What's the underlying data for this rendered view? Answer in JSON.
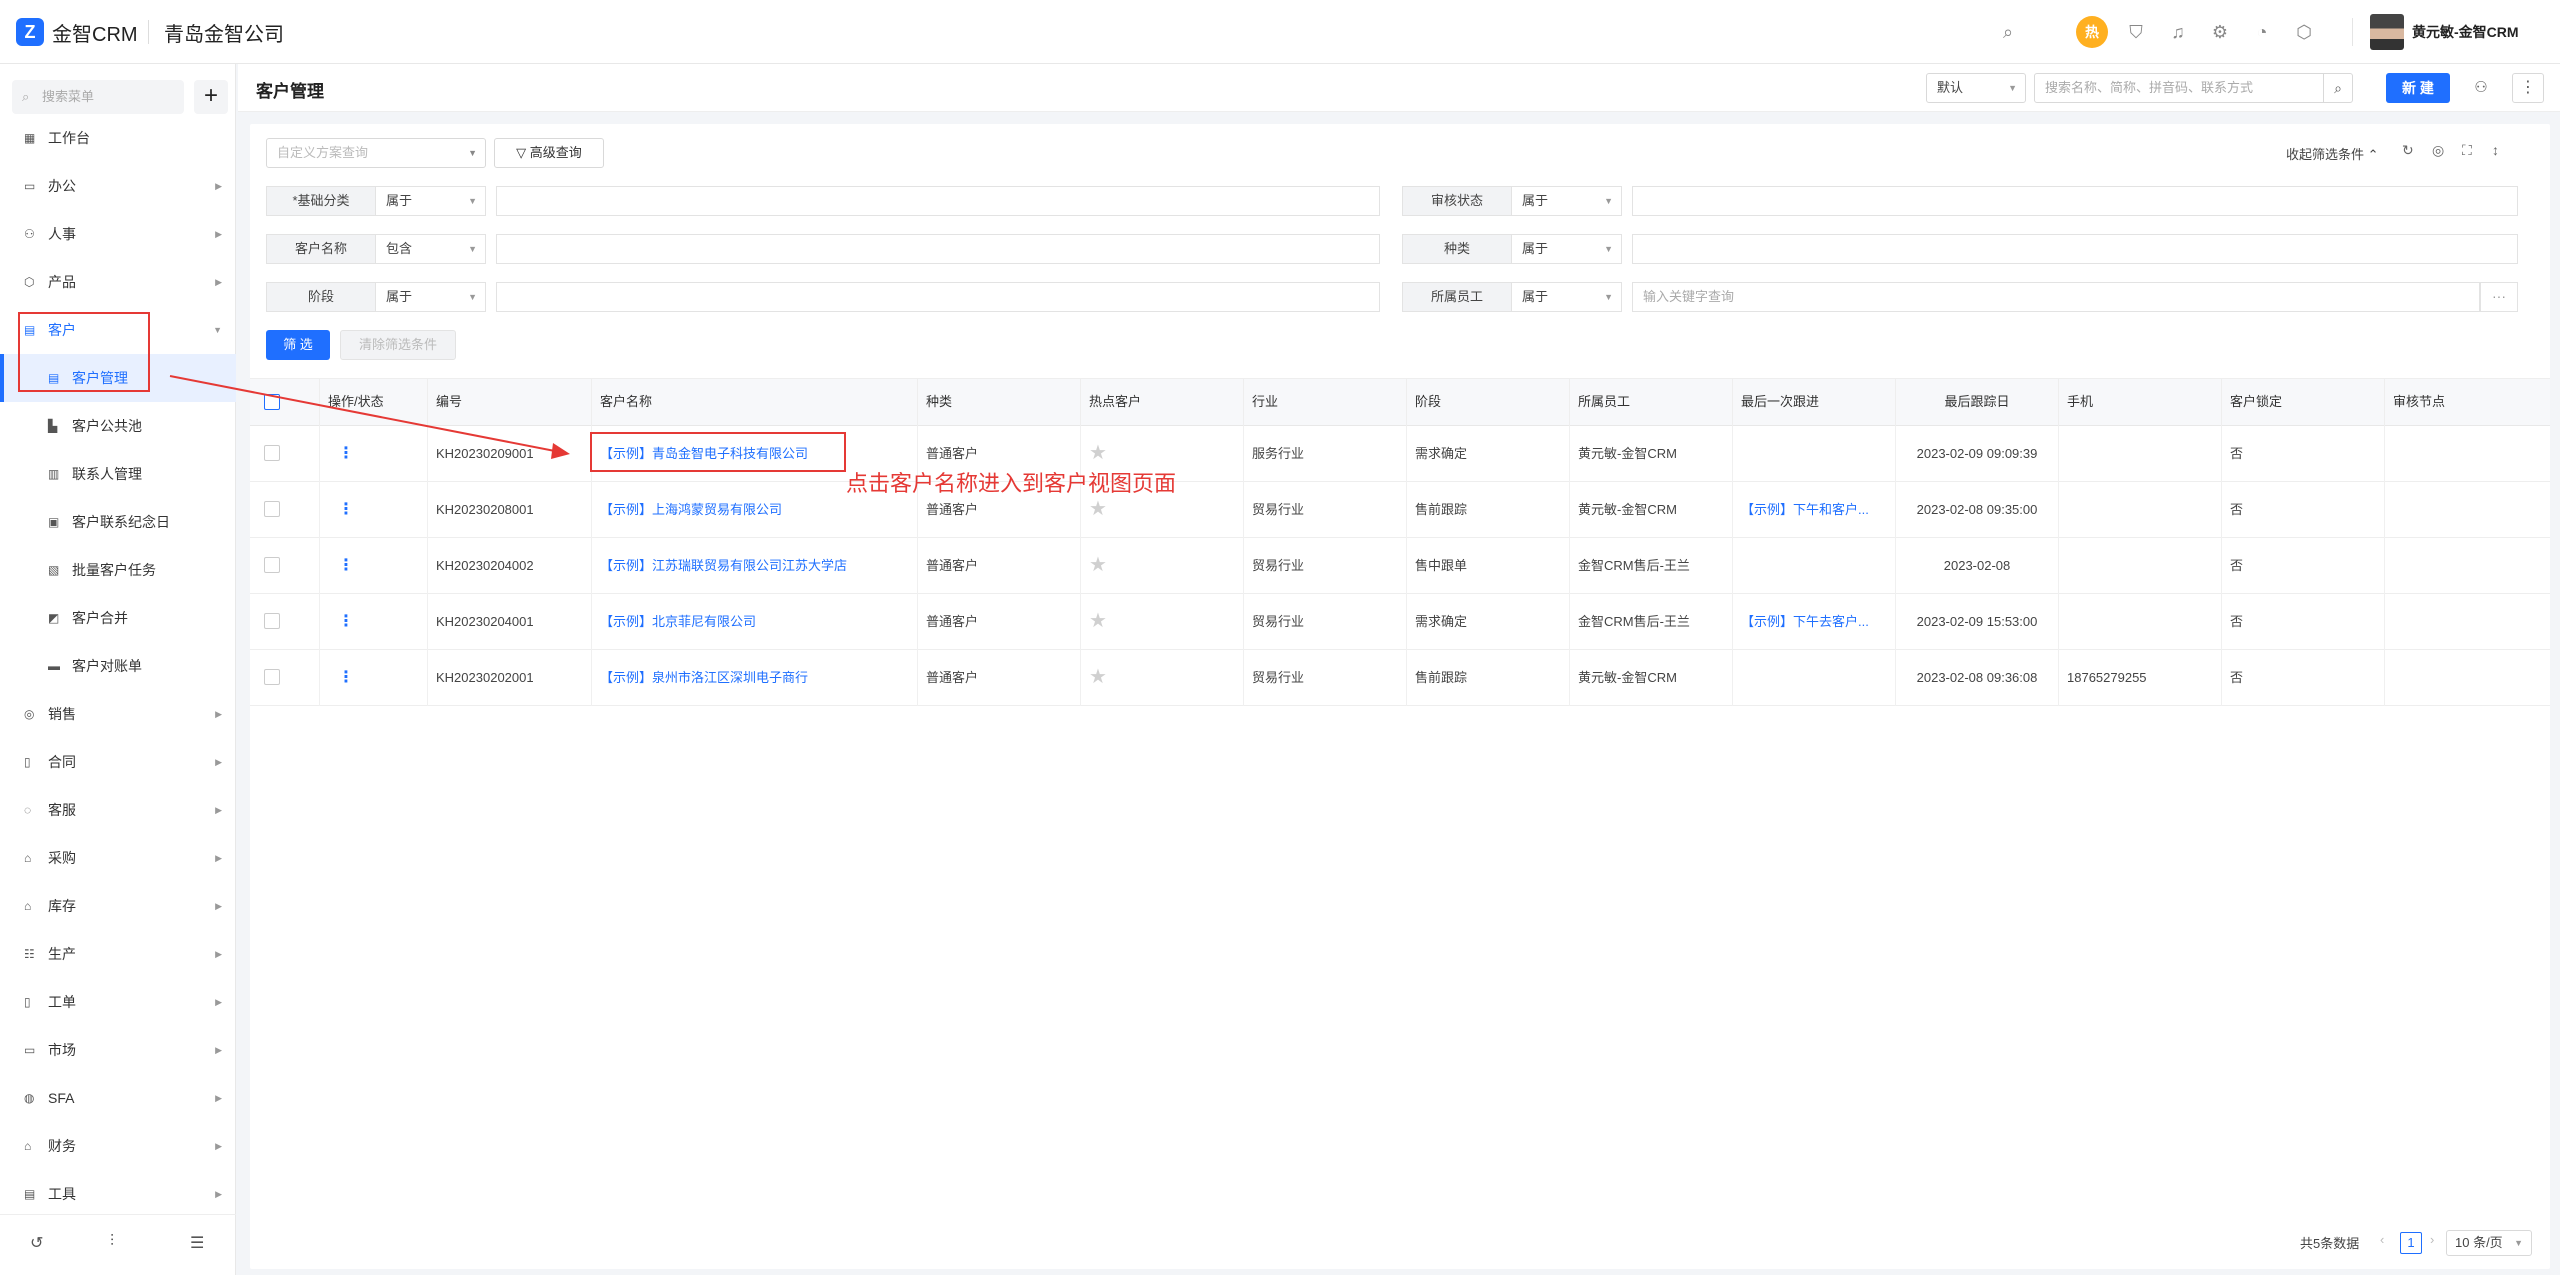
{
  "header": {
    "logo_glyph": "Z",
    "brand": "金智CRM",
    "company": "青岛金智公司",
    "user_name": "黄元敏-金智CRM",
    "hot_badge": "热"
  },
  "sidebar": {
    "search_placeholder": "搜索菜单",
    "add_label": "+",
    "items": [
      {
        "label": "工作台",
        "icon": "dashboard-icon"
      },
      {
        "label": "办公",
        "icon": "office-icon"
      },
      {
        "label": "人事",
        "icon": "people-icon"
      },
      {
        "label": "产品",
        "icon": "product-icon"
      },
      {
        "label": "客户",
        "icon": "customer-icon"
      },
      {
        "label": "销售",
        "icon": "sales-icon"
      },
      {
        "label": "合同",
        "icon": "contract-icon"
      },
      {
        "label": "客服",
        "icon": "service-icon"
      },
      {
        "label": "采购",
        "icon": "purchase-icon"
      },
      {
        "label": "库存",
        "icon": "inventory-icon"
      },
      {
        "label": "生产",
        "icon": "production-icon"
      },
      {
        "label": "工单",
        "icon": "workorder-icon"
      },
      {
        "label": "市场",
        "icon": "market-icon"
      },
      {
        "label": "SFA",
        "icon": "sfa-icon"
      },
      {
        "label": "财务",
        "icon": "finance-icon"
      },
      {
        "label": "工具",
        "icon": "tools-icon"
      }
    ],
    "sub_items": [
      "客户管理",
      "客户公共池",
      "联系人管理",
      "客户联系纪念日",
      "批量客户任务",
      "客户合并",
      "客户对账单"
    ]
  },
  "main": {
    "page_title": "客户管理",
    "view_select": "默认",
    "search_placeholder": "搜索名称、简称、拼音码、联系方式",
    "new_button": "新 建",
    "plan_placeholder": "自定义方案查询",
    "advanced_query": "高级查询",
    "collapse_filters": "收起筛选条件",
    "filters": [
      {
        "label": "*基础分类",
        "op": "属于",
        "value": ""
      },
      {
        "label": "审核状态",
        "op": "属于",
        "value": ""
      },
      {
        "label": "客户名称",
        "op": "包含",
        "value": ""
      },
      {
        "label": "种类",
        "op": "属于",
        "value": ""
      },
      {
        "label": "阶段",
        "op": "属于",
        "value": ""
      },
      {
        "label": "所属员工",
        "op": "属于",
        "value": "输入关键字查询"
      }
    ],
    "filter_button": "筛 选",
    "clear_button": "清除筛选条件"
  },
  "table": {
    "columns": [
      "操作/状态",
      "编号",
      "客户名称",
      "种类",
      "热点客户",
      "行业",
      "阶段",
      "所属员工",
      "最后一次跟进",
      "最后跟踪日",
      "手机",
      "客户锁定",
      "审核节点"
    ],
    "rows": [
      {
        "code": "KH20230209001",
        "name": "【示例】青岛金智电子科技有限公司",
        "kind": "普通客户",
        "industry": "服务行业",
        "stage": "需求确定",
        "owner": "黄元敏-金智CRM",
        "last_follow": "",
        "last_date": "2023-02-09 09:09:39",
        "mobile": "",
        "locked": "否"
      },
      {
        "code": "KH20230208001",
        "name": "【示例】上海鸿蒙贸易有限公司",
        "kind": "普通客户",
        "industry": "贸易行业",
        "stage": "售前跟踪",
        "owner": "黄元敏-金智CRM",
        "last_follow": "【示例】下午和客户...",
        "last_date": "2023-02-08 09:35:00",
        "mobile": "",
        "locked": "否"
      },
      {
        "code": "KH20230204002",
        "name": "【示例】江苏瑞联贸易有限公司江苏大学店",
        "kind": "普通客户",
        "industry": "贸易行业",
        "stage": "售中跟单",
        "owner": "金智CRM售后-王兰",
        "last_follow": "",
        "last_date": "2023-02-08",
        "mobile": "",
        "locked": "否"
      },
      {
        "code": "KH20230204001",
        "name": "【示例】北京菲尼有限公司",
        "kind": "普通客户",
        "industry": "贸易行业",
        "stage": "需求确定",
        "owner": "金智CRM售后-王兰",
        "last_follow": "【示例】下午去客户...",
        "last_date": "2023-02-09 15:53:00",
        "mobile": "",
        "locked": "否"
      },
      {
        "code": "KH20230202001",
        "name": "【示例】泉州市洛江区深圳电子商行",
        "kind": "普通客户",
        "industry": "贸易行业",
        "stage": "售前跟踪",
        "owner": "黄元敏-金智CRM",
        "last_follow": "",
        "last_date": "2023-02-08 09:36:08",
        "mobile": "18765279255",
        "locked": "否"
      }
    ]
  },
  "annotation": "点击客户名称进入到客户视图页面",
  "pagination": {
    "total": "共5条数据",
    "current": "1",
    "page_size": "10 条/页"
  }
}
